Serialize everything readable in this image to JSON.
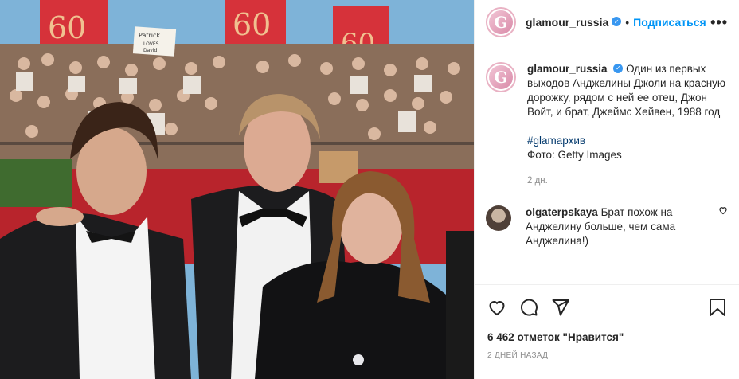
{
  "post": {
    "username": "glamour_russia",
    "follow_label": "Подписаться",
    "more_label": "•••",
    "avatar_letter": "G",
    "caption_text": "Один из первых выходов Анджелины Джоли на красную дорожку, рядом с ней ее отец, Джон Войт, и брат, Джеймс Хейвен, 1988 год",
    "hashtag": "#glamархив",
    "credit": "Фото: Getty Images",
    "age": "2 дн.",
    "likes": "6 462 отметок \"Нравится\"",
    "date": "2 ДНЕЙ НАЗАД"
  },
  "comments": [
    {
      "username": "olgaterpskaya",
      "text": "Брат похож на Анджелину больше, чем сама Анджелина!)"
    }
  ],
  "photo": {
    "sign_text_1": "Patrick",
    "sign_text_2": "LOVES",
    "sign_text_3": "David"
  },
  "colors": {
    "accent": "#0095f6",
    "hashtag": "#00376b",
    "banner_red": "#d6323a"
  },
  "icons": [
    "verified-icon",
    "more-icon",
    "heart-icon",
    "comment-icon",
    "share-icon",
    "bookmark-icon",
    "avatar-logo-icon"
  ]
}
